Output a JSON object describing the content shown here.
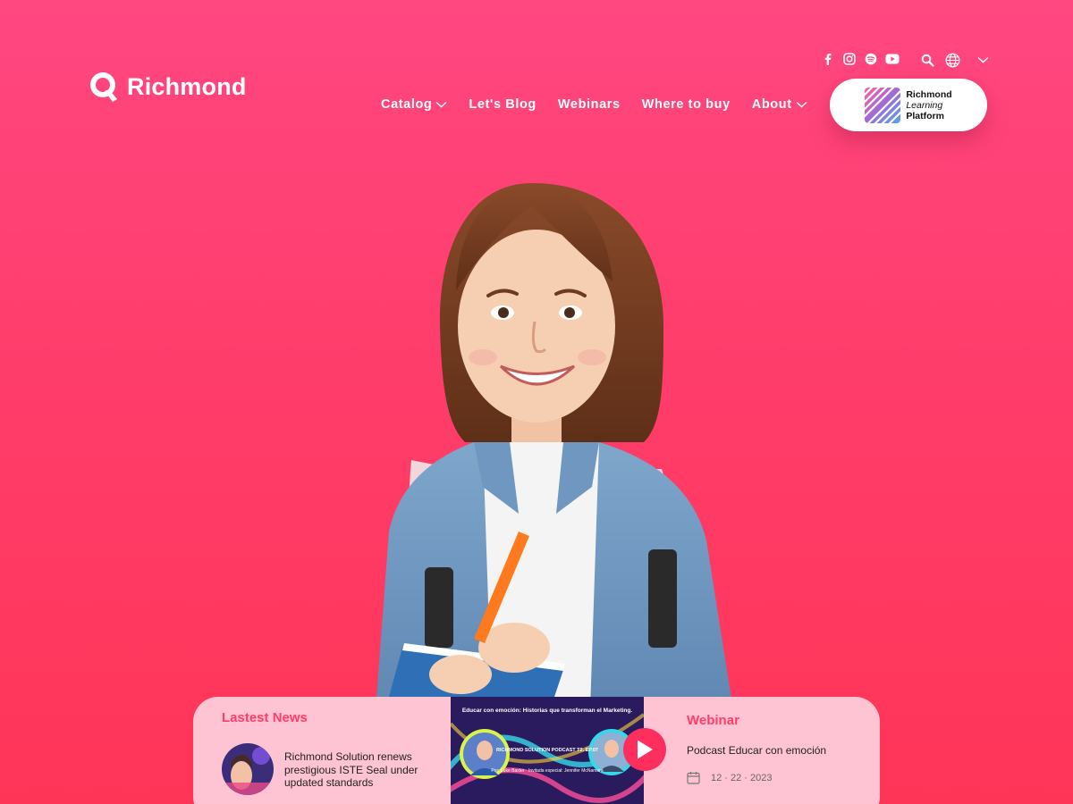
{
  "brand": {
    "name": "Richmond"
  },
  "social": [
    "facebook-icon",
    "instagram-icon",
    "spotify-icon",
    "youtube-icon"
  ],
  "utility": [
    "search-icon",
    "globe-icon",
    "chevron-down-icon"
  ],
  "nav": [
    {
      "label": "Catalog",
      "dropdown": true
    },
    {
      "label": "Let's Blog",
      "dropdown": false
    },
    {
      "label": "Webinars",
      "dropdown": false
    },
    {
      "label": "Where to buy",
      "dropdown": false
    },
    {
      "label": "About",
      "dropdown": true
    }
  ],
  "platform_button": {
    "line1": "Richmond",
    "line2": "Learning",
    "line3": "Platform"
  },
  "news": {
    "title": "Lastest News",
    "item": {
      "text": "Richmond Solution renews prestigious ISTE Seal under updated standards"
    }
  },
  "video": {
    "title": "Educar con emoción: Historias que transforman el Marketing.",
    "subtitle": "RICHMOND SOLUTION PODCAST T2. EP.07",
    "guests": "Por: Luke Baxter · Invitada especial: Jennifer McNamara"
  },
  "webinar": {
    "title": "Webinar",
    "description": "Podcast Educar con emoción",
    "date": "12 · 22 · 2023"
  },
  "colors": {
    "background": "#ff4474",
    "accent": "#ff3e6a",
    "card": "#ffc4d4"
  }
}
